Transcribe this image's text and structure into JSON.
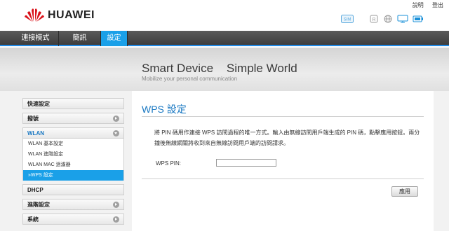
{
  "header": {
    "brand": "HUAWEI",
    "links": {
      "help": "說明",
      "logout": "登出"
    },
    "status_icons": [
      "sim-icon",
      "roaming-icon",
      "globe-icon",
      "monitor-icon",
      "battery-icon"
    ],
    "sim_label": "SIM",
    "roaming_label": "R"
  },
  "nav": {
    "tabs": [
      {
        "label": "連接模式",
        "active": false
      },
      {
        "label": "簡訊",
        "active": false
      },
      {
        "label": "設定",
        "active": true
      }
    ]
  },
  "banner": {
    "title": "Smart Device    Simple World",
    "subtitle": "Mobilize your personal communication"
  },
  "sidebar": {
    "items": [
      {
        "label": "快速設定"
      },
      {
        "label": "撥號"
      },
      {
        "label": "WLAN",
        "expanded": true,
        "children": [
          {
            "label": "WLAN 基本設定"
          },
          {
            "label": "WLAN 進階設定"
          },
          {
            "label": "WLAN MAC 過濾器"
          },
          {
            "label": "»WPS 設定",
            "active": true
          }
        ]
      },
      {
        "label": "DHCP"
      },
      {
        "label": "進階設定"
      },
      {
        "label": "系統"
      }
    ]
  },
  "content": {
    "title": "WPS 設定",
    "description": "將 PIN 碼用作連接 WPS 訪問過程的唯一方式。輸入由無線訪問用戶端生成的 PIN 碼，點擊應用按鈕。兩分鐘後無線網關將收到來自無線訪問用戶端的訪問請求。",
    "pin_label": "WPS PIN:",
    "pin_value": "",
    "apply_label": "應用"
  },
  "colors": {
    "accent": "#1aa0e8",
    "title": "#1a78c2",
    "nav_bg": "#444444",
    "brand_red": "#d9121a"
  }
}
